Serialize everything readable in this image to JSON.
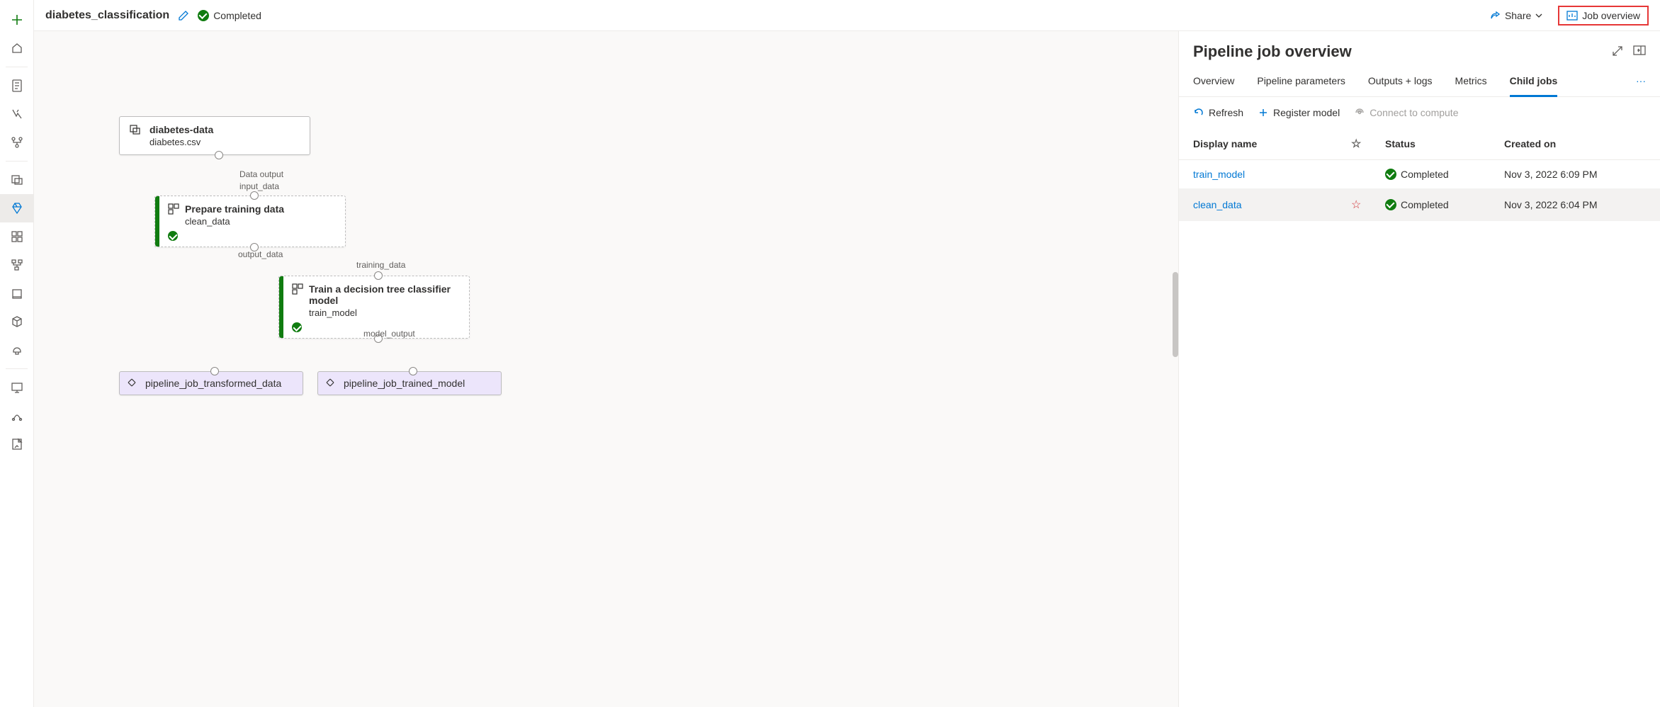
{
  "header": {
    "title": "diabetes_classification",
    "status": "Completed",
    "share": "Share",
    "jobOverview": "Job overview"
  },
  "canvas": {
    "node1": {
      "title": "diabetes-data",
      "sub": "diabetes.csv"
    },
    "node1_port_out": "Data output",
    "node2_port_in": "input_data",
    "node2": {
      "title": "Prepare training data",
      "sub": "clean_data"
    },
    "node2_port_out": "output_data",
    "node3_port_in": "training_data",
    "node3": {
      "title": "Train a decision tree classifier model",
      "sub": "train_model"
    },
    "node3_port_out": "model_output",
    "node4": {
      "title": "pipeline_job_transformed_data"
    },
    "node5": {
      "title": "pipeline_job_trained_model"
    }
  },
  "panel": {
    "title": "Pipeline job overview",
    "tabs": {
      "overview": "Overview",
      "params": "Pipeline parameters",
      "outputs": "Outputs + logs",
      "metrics": "Metrics",
      "children": "Child jobs"
    },
    "tools": {
      "refresh": "Refresh",
      "register": "Register model",
      "connect": "Connect to compute"
    },
    "columns": {
      "name": "Display name",
      "status": "Status",
      "created": "Created on"
    },
    "rows": [
      {
        "name": "train_model",
        "status": "Completed",
        "created": "Nov 3, 2022 6:09 PM"
      },
      {
        "name": "clean_data",
        "status": "Completed",
        "created": "Nov 3, 2022 6:04 PM"
      }
    ]
  }
}
